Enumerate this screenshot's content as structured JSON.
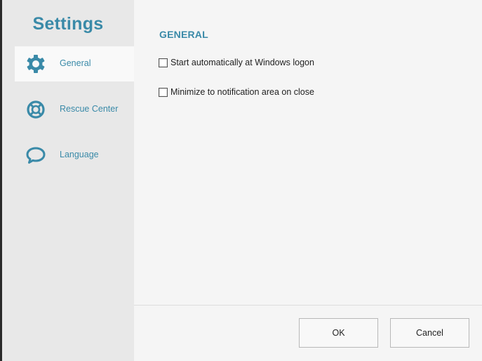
{
  "sidebar": {
    "title": "Settings",
    "items": [
      {
        "label": "General",
        "icon": "gear-icon",
        "active": true
      },
      {
        "label": "Rescue Center",
        "icon": "lifebuoy-icon",
        "active": false
      },
      {
        "label": "Language",
        "icon": "speech-bubble-icon",
        "active": false
      }
    ]
  },
  "general": {
    "heading": "GENERAL",
    "options": [
      {
        "label": "Start automatically at Windows logon",
        "checked": false
      },
      {
        "label": "Minimize to notification area on close",
        "checked": false
      }
    ]
  },
  "footer": {
    "ok_label": "OK",
    "cancel_label": "Cancel"
  },
  "colors": {
    "accent": "#3a8aa8",
    "sidebar_bg": "#e8e8e8",
    "content_bg": "#f5f5f5"
  }
}
